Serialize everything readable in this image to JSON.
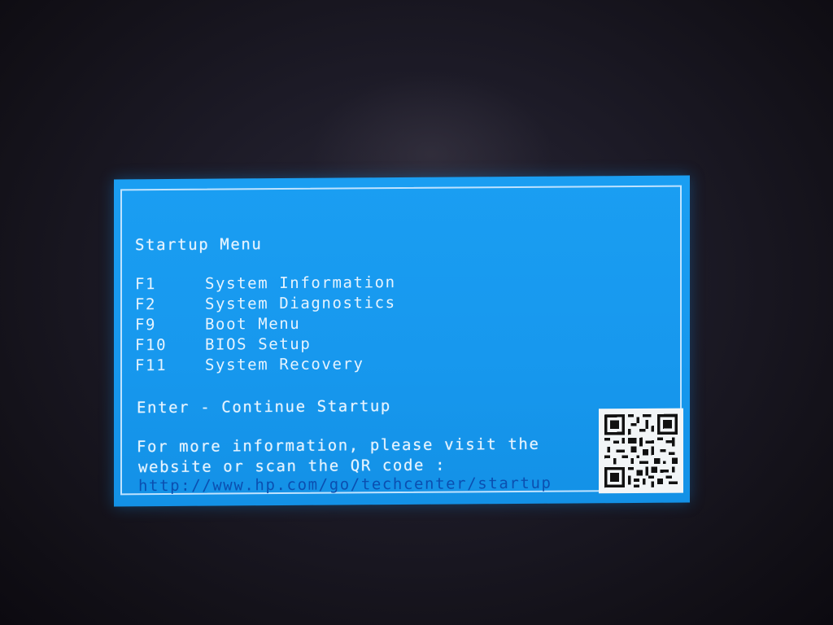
{
  "startup_menu": {
    "title": "Startup Menu",
    "items": [
      {
        "key": "F1",
        "label": "System Information"
      },
      {
        "key": "F2",
        "label": "System Diagnostics"
      },
      {
        "key": "F9",
        "label": "Boot Menu"
      },
      {
        "key": "F10",
        "label": "BIOS Setup"
      },
      {
        "key": "F11",
        "label": "System Recovery"
      }
    ],
    "continue_text": "Enter - Continue Startup",
    "info_line1": "For more information, please visit the",
    "info_line2": "website or scan the QR code :",
    "url": "http://www.hp.com/go/techcenter/startup",
    "qr_icon": "qr-code-icon"
  },
  "colors": {
    "screen_blue": "#1798ee",
    "text": "#e6f4ff",
    "url": "#0b4fb0",
    "border": "#bfe3ff"
  }
}
